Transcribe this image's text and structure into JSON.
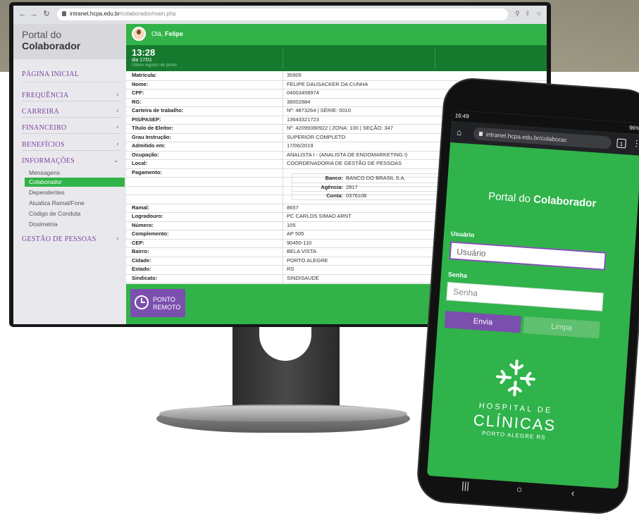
{
  "browser": {
    "url_host": "intranet.hcpa.edu.br",
    "url_path": "/colaborador/main.php"
  },
  "sidebar": {
    "title_line1": "Portal do",
    "title_line2": "Colaborador",
    "items": [
      {
        "label": "PÁGINA INICIAL",
        "chevron": ""
      },
      {
        "label": "FREQUÊNCIA",
        "chevron": "‹"
      },
      {
        "label": "CARREIRA",
        "chevron": "‹"
      },
      {
        "label": "FINANCEIRO",
        "chevron": "‹"
      },
      {
        "label": "BENEFÍCIOS",
        "chevron": "‹"
      },
      {
        "label": "INFORMAÇÕES",
        "chevron": "⌄"
      },
      {
        "label": "GESTÃO DE PESSOAS",
        "chevron": "‹"
      }
    ],
    "subitems": [
      {
        "label": "Mensagens"
      },
      {
        "label": "Colaborador"
      },
      {
        "label": "Dependentes"
      },
      {
        "label": "Atualiza Ramal/Fone"
      },
      {
        "label": "Código de Conduta"
      },
      {
        "label": "Dosimetria"
      }
    ]
  },
  "header": {
    "greeting_prefix": "Olá, ",
    "user_name": "Felipe"
  },
  "clock": {
    "time": "13:28",
    "day": "dia 17/01",
    "note": "Último registro de ponto"
  },
  "info_rows": [
    {
      "label": "Matrícula:",
      "value": "35905"
    },
    {
      "label": "Nome:",
      "value": "FELIPE DAUSACKER DA CUNHA"
    },
    {
      "label": "CPF:",
      "value": "04003458974"
    },
    {
      "label": "RG:",
      "value": "38002884"
    },
    {
      "label": "Carteira de trabalho:",
      "value": "Nº: 4873264 | SÉRIE: 0010"
    },
    {
      "label": "PIS/PASEP:",
      "value": "13643321723"
    },
    {
      "label": "Título de Eleitor:",
      "value": "Nº: 42099380922 | ZONA: 100 | SEÇÃO: 347"
    },
    {
      "label": "Grau Instrução:",
      "value": "SUPERIOR COMPLETO"
    },
    {
      "label": "Admitido em:",
      "value": "17/06/2019"
    },
    {
      "label": "Ocupação:",
      "value": "ANALISTA I - (ANALISTA DE ENDOMARKETING I)"
    },
    {
      "label": "Local:",
      "value": "COORDENADORIA DE GESTÃO DE PESSOAS"
    },
    {
      "label": "Pagamento:",
      "value": ""
    },
    {
      "label": "",
      "value": ""
    },
    {
      "label": "",
      "value": ""
    },
    {
      "label": "",
      "value": ""
    },
    {
      "label": "Ramal:",
      "value": "8657"
    },
    {
      "label": "Logradouro:",
      "value": "PC CARLOS SIMAO ARNT"
    },
    {
      "label": "Número:",
      "value": "105"
    },
    {
      "label": "Complemento:",
      "value": "AP 505"
    },
    {
      "label": "CEP:",
      "value": "90450-110"
    },
    {
      "label": "Bairro:",
      "value": "BELA VISTA"
    },
    {
      "label": "Cidade:",
      "value": "PORTO ALEGRE"
    },
    {
      "label": "Estado:",
      "value": "RS"
    },
    {
      "label": "Sindicato:",
      "value": "SINDISAUDE"
    }
  ],
  "payment": {
    "bank_label": "Banco:",
    "bank": "BANCO DO BRASIL S.A.",
    "agency_label": "Agência:",
    "agency": "2817",
    "account_label": "Conta:",
    "account": "0376108"
  },
  "ponto_button": {
    "line1": "PONTO",
    "line2": "REMOTO"
  },
  "phone": {
    "status_time": "16:49",
    "status_battery": "96%",
    "url": "intranet.hcpa.edu.br/colaborac",
    "tabs_count": "1",
    "title_prefix": "Portal do ",
    "title_bold": "Colaborador",
    "user_label": "Usuário",
    "user_placeholder": "Usuário",
    "password_label": "Senha",
    "password_placeholder": "Senha",
    "send_button": "Envia",
    "clear_button": "Limpa",
    "logo_line1": "HOSPITAL DE",
    "logo_line2": "CLÍNICAS",
    "logo_line3": "PORTO ALEGRE    RS"
  },
  "colors": {
    "accent_green": "#32b34a",
    "dark_green": "#167a2e",
    "purple": "#7b4fae"
  }
}
